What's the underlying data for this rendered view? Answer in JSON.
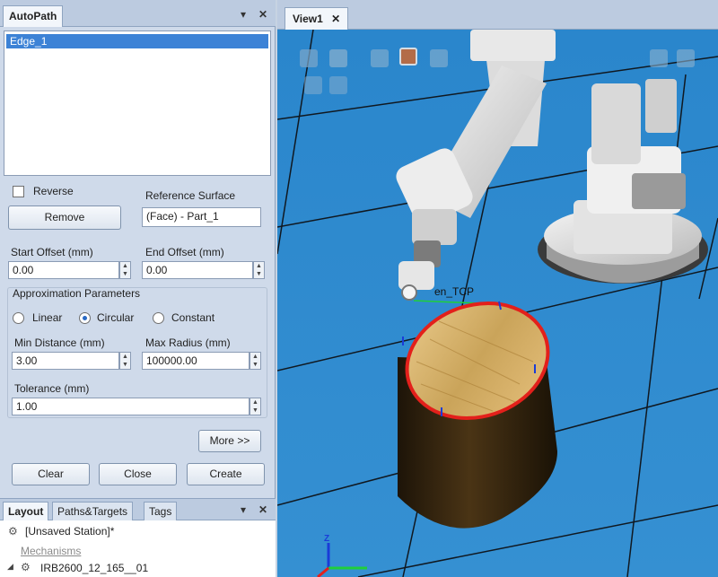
{
  "autopath": {
    "title": "AutoPath",
    "list_items": [
      "Edge_1"
    ],
    "reverse_label": "Reverse",
    "reference_surface_label": "Reference Surface",
    "reference_surface_value": "(Face) - Part_1",
    "remove_label": "Remove",
    "start_offset_label": "Start Offset (mm)",
    "start_offset_value": "0.00",
    "end_offset_label": "End Offset (mm)",
    "end_offset_value": "0.00",
    "approx_label": "Approximation Parameters",
    "linear_label": "Linear",
    "circular_label": "Circular",
    "constant_label": "Constant",
    "min_distance_label": "Min Distance (mm)",
    "min_distance_value": "3.00",
    "max_radius_label": "Max Radius (mm)",
    "max_radius_value": "100000.00",
    "tolerance_label": "Tolerance (mm)",
    "tolerance_value": "1.00",
    "more_label": "More >>",
    "clear_label": "Clear",
    "close_label": "Close",
    "create_label": "Create"
  },
  "bottom_dock": {
    "tabs": [
      "Layout",
      "Paths&Targets",
      "Tags"
    ],
    "station": "[Unsaved Station]*",
    "mechanisms": "Mechanisms",
    "robot": "IRB2600_12_165__01"
  },
  "view": {
    "tab_label": "View1",
    "tcp_label": "en_TCP"
  },
  "colors": {
    "panel_bg": "#cfdaea",
    "selection": "#3c82d6",
    "viewport": "#2f86c9",
    "edge_highlight": "#e3201b"
  }
}
